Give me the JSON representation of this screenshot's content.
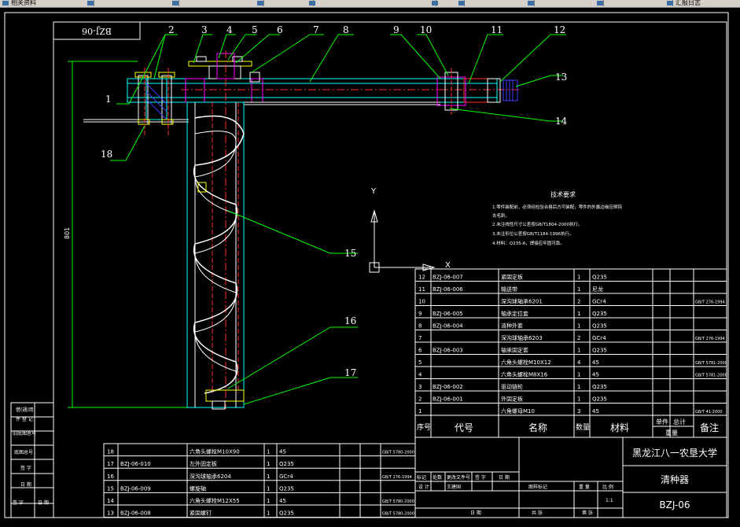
{
  "window": {
    "tabs": [
      "相关资料",
      "",
      "",
      "",
      "",
      "",
      "",
      "",
      "汇报日志"
    ]
  },
  "drawing": {
    "rotated_code": "BZJ-06",
    "vertical_dim": "801",
    "axis_y_label": "Y",
    "axis_x_label": "X",
    "balloons": [
      "1",
      "2",
      "3",
      "4",
      "5",
      "6",
      "7",
      "8",
      "9",
      "10",
      "11",
      "12",
      "13",
      "14",
      "15",
      "16",
      "17",
      "18"
    ]
  },
  "tech_req": {
    "title": "技术要求",
    "lines": [
      "1.零件装配前，必须经检验合格后方可装配，零件的外露边缘应倒钝",
      "去毛刺。",
      "2.未注线性尺寸公差按GB/T1804-2000执行。",
      "3.未注形位公差按GB/T1184-1996执行。",
      "4.材料：Q235-A，焊接应牢固可靠。"
    ]
  },
  "bom_upper": {
    "rows": [
      [
        "12",
        "BZJ-06-007",
        "紧固定板",
        "1",
        "Q235",
        ""
      ],
      [
        "11",
        "BZJ-06-006",
        "输送带",
        "1",
        "尼龙",
        ""
      ],
      [
        "10",
        "",
        "深沟球轴承6201",
        "2",
        "GCr4",
        "GB/T 276-1994"
      ],
      [
        "9",
        "BZJ-06-005",
        "轴承定位套",
        "1",
        "Q235",
        ""
      ],
      [
        "8",
        "BZJ-06-004",
        "清种外套",
        "1",
        "Q235",
        ""
      ],
      [
        "7",
        "",
        "深沟球轴承6203",
        "2",
        "GCr4",
        "GB/T 276-1994"
      ],
      [
        "6",
        "BZJ-06-003",
        "轴承固定套",
        "1",
        "Q235",
        ""
      ],
      [
        "5",
        "",
        "六角头螺栓M10X12",
        "4",
        "45",
        "GB/T 5781-2000"
      ],
      [
        "4",
        "",
        "六角头螺栓M8X16",
        "1",
        "45",
        "GB/T 5781-2000"
      ],
      [
        "3",
        "BZJ-06-002",
        "驱动链轮",
        "1",
        "Q235",
        ""
      ],
      [
        "2",
        "BZJ-06-001",
        "外固定板",
        "1",
        "Q235",
        ""
      ],
      [
        "1",
        "",
        "六角螺母M10",
        "3",
        "45",
        "GB/T 41-2000"
      ]
    ],
    "header": {
      "seq": "序号",
      "code": "代号",
      "name": "名称",
      "qty": "数量",
      "mat": "材料",
      "unit": "单件",
      "total": "总计",
      "weight": "重量",
      "note": "备注"
    }
  },
  "bom_lower": {
    "rows": [
      [
        "18",
        "",
        "六角头螺栓M10X90",
        "1",
        "45",
        "GB/T 5780-2000"
      ],
      [
        "17",
        "BZJ-06-010",
        "左外固定板",
        "1",
        "Q235",
        ""
      ],
      [
        "16",
        "",
        "深沟球轴承6204",
        "1",
        "GCr4",
        "GB/T 276-1994"
      ],
      [
        "15",
        "BZJ-06-009",
        "螺旋轴",
        "1",
        "Q235",
        ""
      ],
      [
        "14",
        "",
        "六角头螺栓M12X55",
        "1",
        "45",
        "GB/T 5780-2000"
      ],
      [
        "13",
        "BZJ-06-008",
        "紧固螺钉",
        "1",
        "Q235",
        "GB/T 5780-2000"
      ]
    ]
  },
  "title_block": {
    "school": "黑龙江八一农垦大学",
    "part_name": "清种器",
    "drawing_no": "BZJ-06",
    "scale": "1:1",
    "row_labels_a": [
      "标记",
      "处数",
      "更改文件号",
      "签 字",
      "日 期"
    ],
    "row_labels_b": [
      "设 计",
      "王建国"
    ],
    "row_labels_c": [
      "图样标记",
      "重 量",
      "比 例"
    ],
    "row_labels_d": [
      "共 张",
      "第 张"
    ],
    "row_labels_e": [
      "日 期"
    ]
  },
  "left_strip": {
    "labels": [
      "借(通)用",
      "件 登 记",
      "旧底图总号",
      "底图总号",
      "签 字",
      "日 期",
      "签 字",
      "日 期"
    ]
  },
  "colors": {
    "bg": "#000000",
    "frame": "#ffffff",
    "green": "#00ff00",
    "cyan": "#00ffff",
    "red": "#ff3030",
    "magenta": "#ff00ff",
    "blue": "#4040ff",
    "yellow": "#ffff00"
  }
}
